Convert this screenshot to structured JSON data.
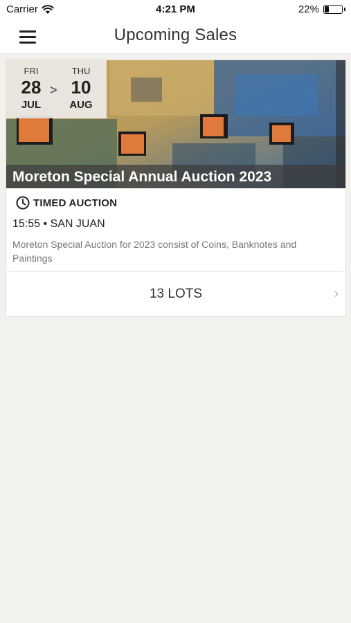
{
  "status_bar": {
    "carrier": "Carrier",
    "time": "4:21 PM",
    "battery_percent": "22%",
    "battery_level": 0.22
  },
  "nav": {
    "title": "Upcoming Sales",
    "menu_icon": "hamburger-icon"
  },
  "sale": {
    "start": {
      "dow": "FRI",
      "day": "28",
      "month": "JUL"
    },
    "end": {
      "dow": "THU",
      "day": "10",
      "month": "AUG"
    },
    "date_separator": ">",
    "title": "Moreton Special Annual Auction 2023",
    "type_icon": "clock-icon",
    "type": "TIMED AUCTION",
    "time_location": "15:55 • SAN JUAN",
    "description": "Moreton Special Auction for 2023 consist of Coins, Banknotes and Paintings",
    "lots_label": "13 LOTS",
    "chevron": "›"
  },
  "colors": {
    "background": "#f2f1ee",
    "card": "#ffffff",
    "caption_overlay": "#3c3c3c"
  }
}
